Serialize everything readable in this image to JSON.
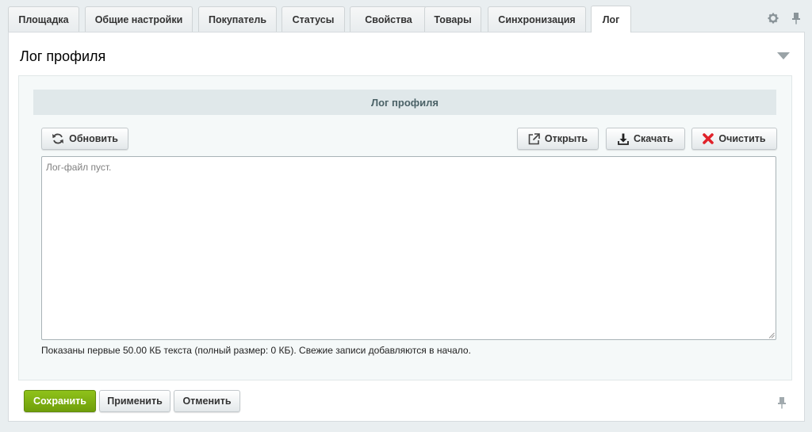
{
  "tabs": [
    {
      "label": "Площадка"
    },
    {
      "label": "Общие настройки"
    },
    {
      "label": "Покупатель"
    },
    {
      "label": "Статусы"
    },
    {
      "label": "Свойства"
    },
    {
      "label": "Товары"
    },
    {
      "label": "Синхронизация"
    },
    {
      "label": "Лог",
      "active": true
    }
  ],
  "tab_icons": [
    "gear-icon",
    "pin-icon"
  ],
  "panel": {
    "title": "Лог профиля",
    "toggle_icon": "triangle-down-icon"
  },
  "log": {
    "header": "Лог профиля",
    "refresh_label": "Обновить",
    "open_label": "Открыть",
    "download_label": "Скачать",
    "clear_label": "Очистить",
    "content": "Лог-файл пуст.",
    "footer": "Показаны первые 50.00 КБ текста (полный размер: 0 КБ). Свежие записи добавляются в начало."
  },
  "actions": {
    "save_label": "Сохранить",
    "apply_label": "Применить",
    "cancel_label": "Отменить"
  },
  "colors": {
    "accent_green": "#7cb00f",
    "clear_icon_red": "#e0222a",
    "background": "#e9eef0"
  }
}
